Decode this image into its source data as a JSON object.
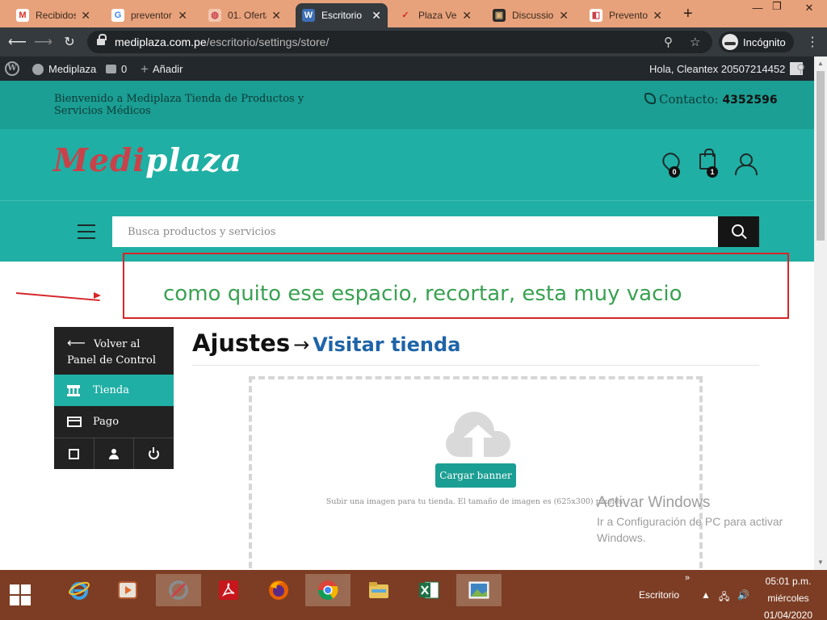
{
  "browser": {
    "tabs": [
      {
        "label": "Recibidos",
        "color": "#ffffff",
        "letter": "M",
        "letter_color": "#d93025",
        "active": false
      },
      {
        "label": "preventor",
        "color": "#ffffff",
        "letter": "G",
        "letter_color": "#4285f4",
        "active": false
      },
      {
        "label": "01. Oferta",
        "color": "#f2c7b0",
        "letter": "◍",
        "letter_color": "#c9424a",
        "active": false
      },
      {
        "label": "Escritorio",
        "color": "#3d6fb6",
        "letter": "W",
        "letter_color": "#ffffff",
        "active": true
      },
      {
        "label": "Plaza Vea",
        "color": "#e8a27b",
        "letter": "✓",
        "letter_color": "#d4262a",
        "active": false
      },
      {
        "label": "Discussion",
        "color": "#2b2b2b",
        "letter": "▣",
        "letter_color": "#d8b27a",
        "active": false
      },
      {
        "label": "Preventor",
        "color": "#ffffff",
        "letter": "◧",
        "letter_color": "#c9424a",
        "active": false
      }
    ],
    "url_host": "mediplaza.com.pe",
    "url_path": "/escritorio/settings/store/",
    "incognito_label": "Incógnito"
  },
  "adminbar": {
    "site_name": "Mediplaza",
    "comments_count": "0",
    "add_label": "Añadir",
    "greeting": "Hola, Cleantex 20507214452"
  },
  "site": {
    "welcome": "Bienvenido a Mediplaza Tienda de Productos y Servicios Médicos",
    "contact_label": "Contacto:",
    "contact_number": "4352596",
    "logo_part1": "Medi",
    "logo_part2": "plaza",
    "wishlist_count": "0",
    "cart_count": "1",
    "search_placeholder": "Busca productos y servicios"
  },
  "annotation": {
    "text": "como quito ese espacio, recortar, esta muy vacio"
  },
  "dashboard": {
    "back_label": "Volver al Panel de Control",
    "store_label": "Tienda",
    "payment_label": "Pago"
  },
  "content": {
    "title": "Ajustes",
    "arrow": "→",
    "visit_label": "Visitar tienda",
    "upload_button": "Cargar banner",
    "upload_hint": "Subir una imagen para tu tienda. El tamaño de imagen es (625x300) pixeles."
  },
  "windows_watermark": {
    "title": "Activar Windows",
    "subtitle": "Ir a Configuración de PC para activar Windows."
  },
  "taskbar": {
    "desktop_label": "Escritorio",
    "time": "05:01 p.m.",
    "day": "miércoles",
    "date": "01/04/2020"
  },
  "colors": {
    "teal_dark": "#1b9e93",
    "teal": "#20afa4",
    "logo_red": "#c9424a",
    "annotation_red": "#d4262a",
    "annotation_green": "#3aa152",
    "taskbar": "#7c3d24"
  }
}
